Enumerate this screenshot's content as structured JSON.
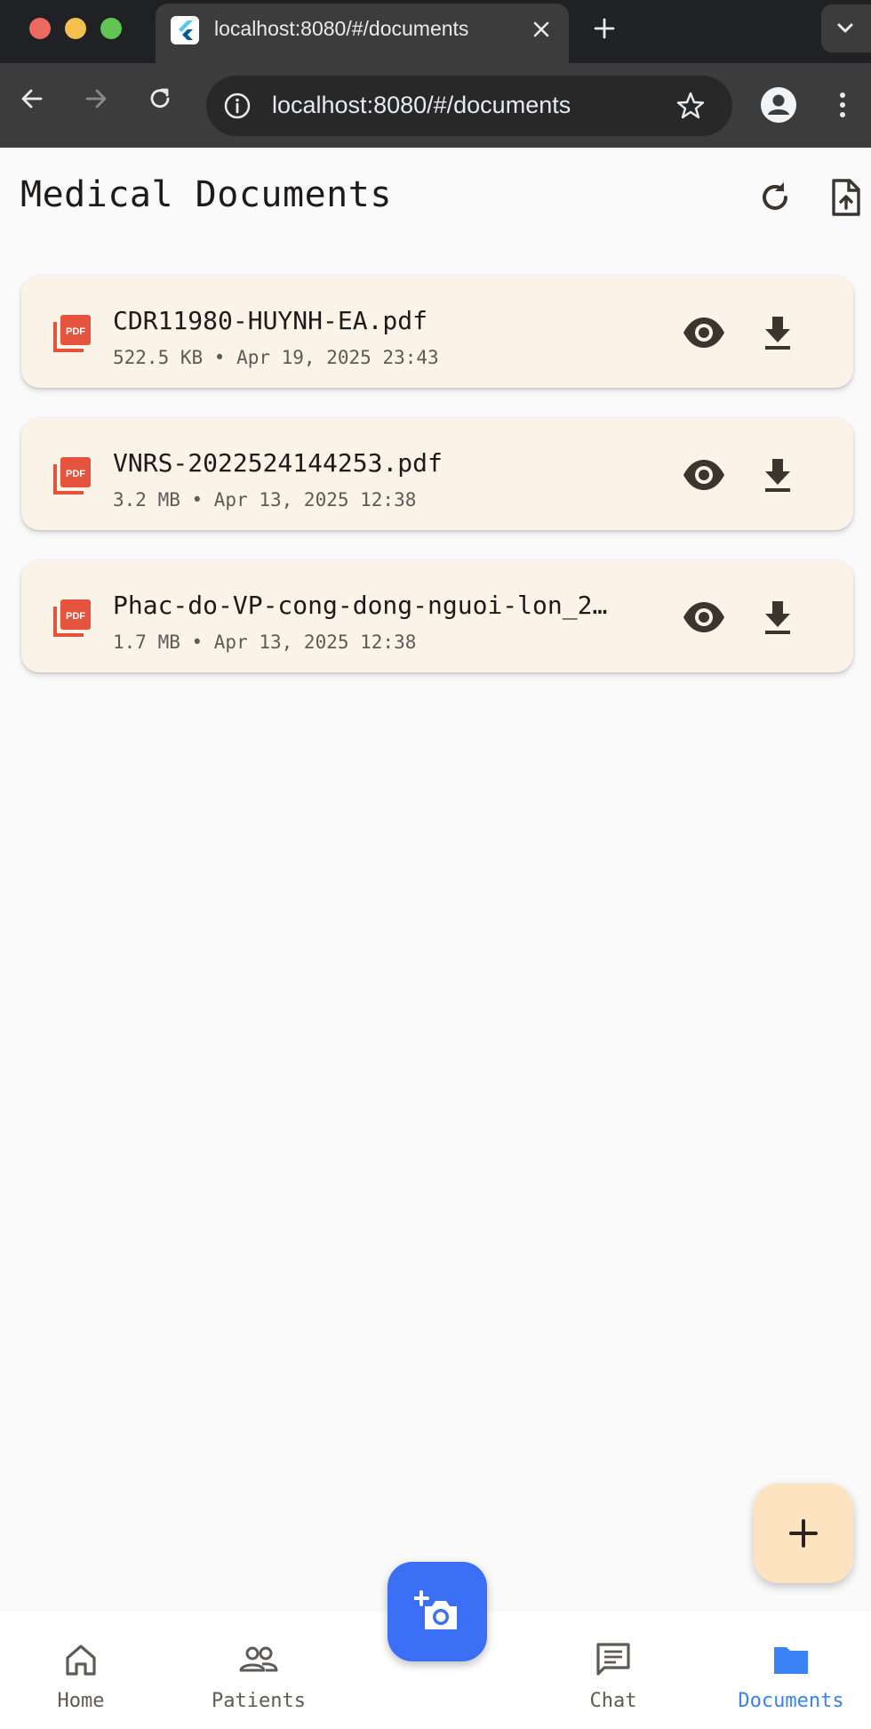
{
  "browser": {
    "tab_title": "localhost:8080/#/documents",
    "url": "localhost:8080/#/documents"
  },
  "header": {
    "title": "Medical Documents"
  },
  "documents": [
    {
      "name": "CDR11980-HUYNH-EA.pdf",
      "meta": "522.5 KB • Apr 19, 2025 23:43"
    },
    {
      "name": "VNRS-2022524144253.pdf",
      "meta": "3.2 MB • Apr 13, 2025 12:38"
    },
    {
      "name": "Phac-do-VP-cong-dong-nguoi-lon_2…",
      "meta": "1.7 MB • Apr 13, 2025 12:38"
    }
  ],
  "nav": {
    "items": [
      {
        "label": "Home",
        "icon": "home-icon"
      },
      {
        "label": "Patients",
        "icon": "people-icon"
      },
      {
        "label": "Chat",
        "icon": "chat-icon"
      },
      {
        "label": "Documents",
        "icon": "folder-icon",
        "active": true
      }
    ]
  },
  "colors": {
    "accent": "#3b82f6",
    "card_bg": "#fbf2e8",
    "pdf_red": "#e5533d",
    "fab_add_bg": "#fde3c0",
    "fab_camera_bg": "#3b6ff5"
  }
}
